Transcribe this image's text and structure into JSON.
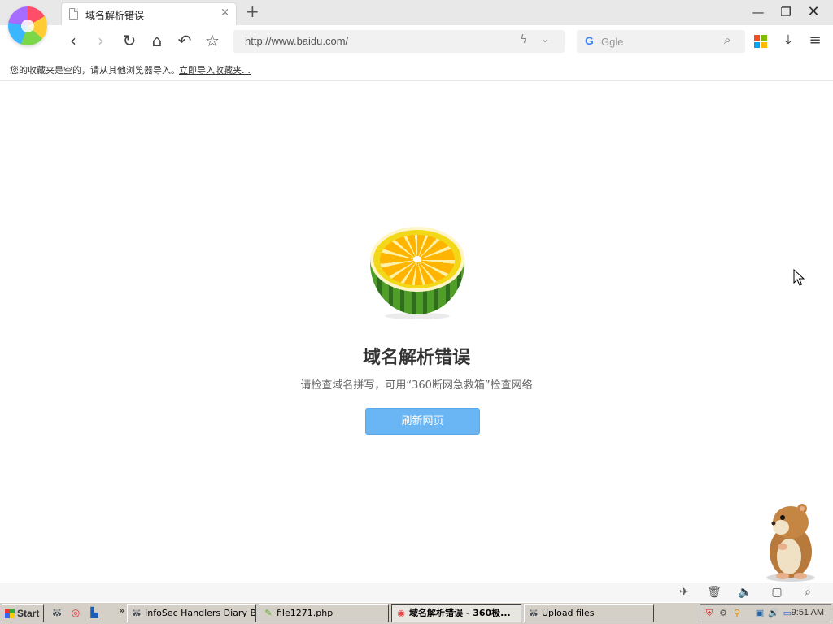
{
  "tab": {
    "title": "域名解析错误",
    "close": "×"
  },
  "new_tab": "+",
  "window_controls": {
    "minimize": "—",
    "maximize": "❐",
    "close": "✕"
  },
  "toolbar": {
    "back": "‹",
    "forward": "›",
    "reload": "↻",
    "home": "⌂",
    "undo": "↶",
    "star": "☆"
  },
  "address": {
    "url": "http://www.baidu.com/",
    "bolt": "ϟ",
    "chevron": "⌄"
  },
  "search": {
    "engine": "G",
    "placeholder": "Ggle",
    "search_icon": "⌕"
  },
  "apps_colors": [
    "#f25022",
    "#7fba00",
    "#00a4ef",
    "#ffb900"
  ],
  "download": "⤓",
  "menu": "≡",
  "bookmark_bar": {
    "message": "您的收藏夹是空的，请从其他浏览器导入。",
    "import_link": "立即导入收藏夹…"
  },
  "error_page": {
    "title": "域名解析错误",
    "description": "请检查域名拼写，可用“360断网急救箱”检查网络",
    "refresh_label": "刷新网页"
  },
  "statusbar_icons": {
    "rocket": "✈",
    "trash": "🗑",
    "speaker": "🔈",
    "window": "▢",
    "zoom": "⌕"
  },
  "taskbar": {
    "start_label": "Start",
    "quicklaunch_more": "»",
    "tasks": [
      {
        "label": "InfoSec Handlers Diary B...",
        "icon": "🦝"
      },
      {
        "label": "file1271.php",
        "icon": "✎"
      },
      {
        "label": "域名解析错误 - 360极...",
        "icon": "◉"
      },
      {
        "label": "Upload files",
        "icon": "🦝"
      }
    ],
    "clock": "9:51 AM"
  }
}
